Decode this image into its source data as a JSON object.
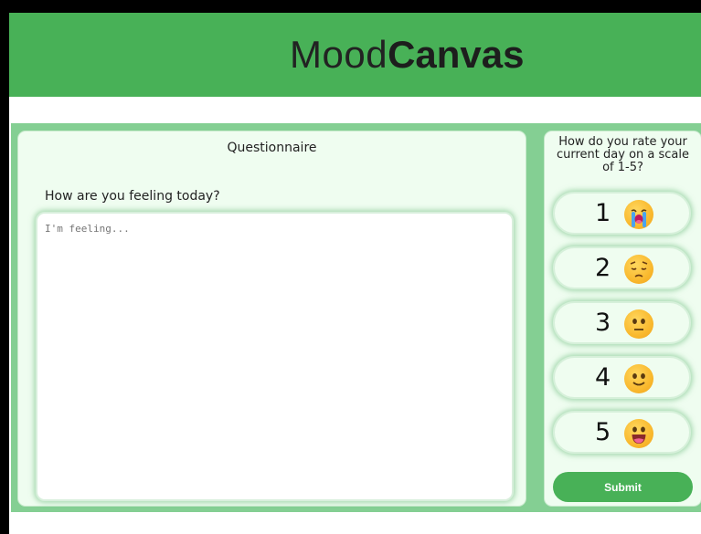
{
  "header": {
    "brand_light": "Mood",
    "brand_bold": "Canvas",
    "color": "#48b157"
  },
  "questionnaire": {
    "title": "Questionnaire",
    "question": "How are you feeling today?",
    "placeholder": "I'm feeling...",
    "value": ""
  },
  "rating": {
    "prompt": "How do you rate your current day on a scale of 1-5?",
    "options": [
      {
        "value": "1",
        "emoji": "loudly-crying-face-icon"
      },
      {
        "value": "2",
        "emoji": "pensive-face-icon"
      },
      {
        "value": "3",
        "emoji": "neutral-face-icon"
      },
      {
        "value": "4",
        "emoji": "slightly-smiling-face-icon"
      },
      {
        "value": "5",
        "emoji": "grinning-face-icon"
      }
    ],
    "submit_label": "Submit"
  },
  "colors": {
    "accent": "#48b157",
    "panel": "#84cf93",
    "card": "#effdf0"
  }
}
